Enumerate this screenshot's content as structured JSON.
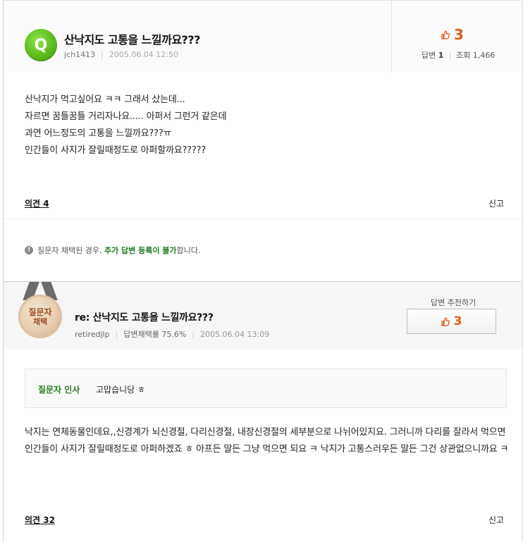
{
  "question": {
    "avatar_letter": "Q",
    "title": "산낙지도 고통을 느낄까요???",
    "author": "jch1413",
    "date": "2005.06.04 12:50",
    "recommend_count": "3",
    "answer_label": "답변",
    "answer_count": "1",
    "views_label": "조회",
    "views_count": "1,466",
    "body_lines": [
      "산낙지가 먹고싶어요 ㅋㅋ 그래서 샀는데...",
      "자르면 꿈틀꿈틀 거리자나요..... 아퍼서 그런거 같은데",
      "과연 어느정도의 고통을 느낄까요???ㅠ",
      "인간들이 사지가 잘릴때정도로 아퍼할까요?????"
    ],
    "opinion_link": "의견 4",
    "report_link": "신고"
  },
  "notice": {
    "icon": "warning-icon",
    "prefix": "질문자 채택된 경우, ",
    "highlight": "추가 답변 등록이 불가",
    "suffix": "합니다."
  },
  "answer": {
    "medal_line1": "질문자",
    "medal_line2": "채택",
    "title": "re: 산낙지도 고통을 느낄까요???",
    "author": "retiredjlp",
    "adoption_rate": "답변채택률 75.6%",
    "date": "2005.06.04 13:09",
    "recommend_label": "답변 추천하기",
    "recommend_count": "3",
    "greeting_label": "질문자 인사",
    "greeting_text": "고맙습니당 ㅎ",
    "body": "낙지는 연체동물인데요,,신경계가 뇌신경절, 다리신경절, 내장신경절의 세부분으로 나뉘어있지요. 그러니까 다리를 잘라서 먹으면 인간들이 사지가 잘릴때정도로 아퍼하겠죠 ㅎ 아프든 말든 그냥 먹으면 되요 ㅋ 낙지가 고통스러우든 말든 그건 상관없으니까요 ㅋ",
    "opinion_link": "의견 32",
    "report_link": "신고"
  },
  "colors": {
    "accent_orange": "#e05a1b",
    "green": "#2a7a1e",
    "avatar_green": "#5cbc1c"
  }
}
